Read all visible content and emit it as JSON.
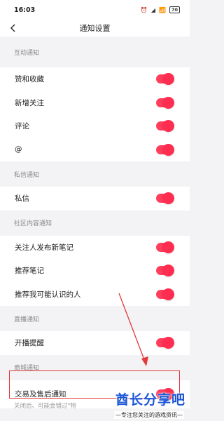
{
  "status_bar": {
    "time": "16:03",
    "battery": "70"
  },
  "header": {
    "title": "通知设置"
  },
  "sections": [
    {
      "title": "互动通知",
      "items": [
        {
          "label": "赞和收藏",
          "on": true
        },
        {
          "label": "新增关注",
          "on": true
        },
        {
          "label": "评论",
          "on": true
        },
        {
          "label": "@",
          "on": true
        }
      ]
    },
    {
      "title": "私信通知",
      "items": [
        {
          "label": "私信",
          "on": true
        }
      ]
    },
    {
      "title": "社区内容通知",
      "items": [
        {
          "label": "关注人发布新笔记",
          "on": true
        },
        {
          "label": "推荐笔记",
          "on": true
        },
        {
          "label": "推荐我可能认识的人",
          "on": true
        }
      ]
    },
    {
      "title": "直播通知",
      "items": [
        {
          "label": "开播提醒",
          "on": true
        }
      ]
    },
    {
      "title": "商城通知",
      "items": [
        {
          "label": "交易及售后通知",
          "on": true
        }
      ]
    }
  ],
  "footnote": "关闭后、可能会错过\"物",
  "watermark": {
    "title": "酋长分享吧",
    "subtitle": "—专注您关注的游戏资讯—"
  },
  "colors": {
    "accent": "#ff2d4f",
    "annotation": "#e23a3a",
    "watermark": "#1a56d6"
  }
}
